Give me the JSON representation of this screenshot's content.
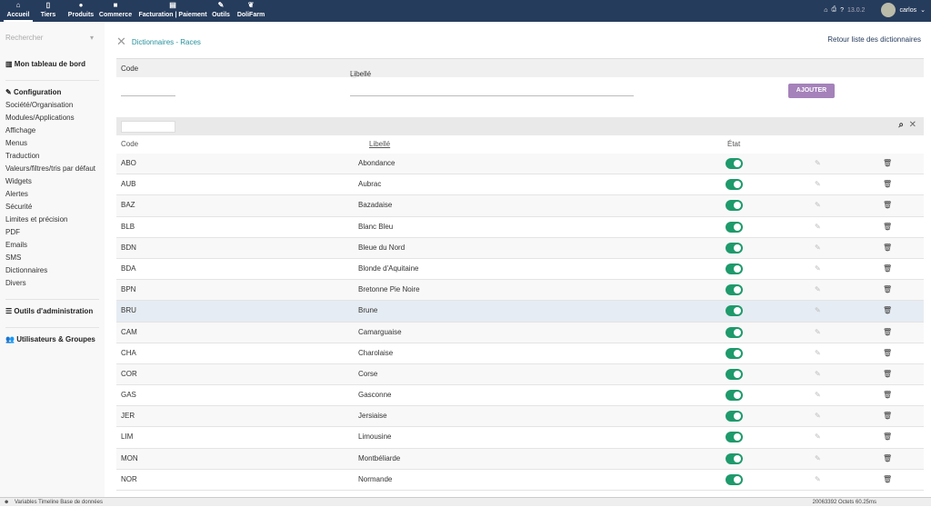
{
  "topbar": {
    "menus": [
      {
        "label": "Accueil",
        "icon": "home-icon",
        "glyph": "⌂"
      },
      {
        "label": "Tiers",
        "icon": "building-icon",
        "glyph": "▯"
      },
      {
        "label": "Produits",
        "icon": "cube-icon",
        "glyph": "●"
      },
      {
        "label": "Commerce",
        "icon": "briefcase-icon",
        "glyph": "■"
      },
      {
        "label": "Facturation | Paiement",
        "icon": "invoice-icon",
        "glyph": "▤"
      },
      {
        "label": "Outils",
        "icon": "wrench-icon",
        "glyph": "✎"
      },
      {
        "label": "DoliFarm",
        "icon": "leaf-icon",
        "glyph": "❦"
      }
    ],
    "version": "13.0.2",
    "user": "carlos"
  },
  "sidebar": {
    "search_placeholder": "Rechercher",
    "dashboard": "Mon tableau de bord",
    "config": "Configuration",
    "config_items": [
      "Société/Organisation",
      "Modules/Applications",
      "Affichage",
      "Menus",
      "Traduction",
      "Valeurs/filtres/tris par défaut",
      "Widgets",
      "Alertes",
      "Sécurité",
      "Limites et précision",
      "PDF",
      "Emails",
      "SMS",
      "Dictionnaires",
      "Divers"
    ],
    "admin_tools": "Outils d'administration",
    "users": "Utilisateurs & Groupes"
  },
  "main": {
    "title": "Dictionnaires - Races",
    "back": "Retour liste des dictionnaires",
    "form": {
      "code_label": "Code",
      "libelle_label": "Libellé",
      "add_button": "AJOUTER"
    },
    "columns": {
      "code": "Code",
      "libelle": "Libellé",
      "etat": "État"
    },
    "rows": [
      {
        "code": "ABO",
        "libelle": "Abondance"
      },
      {
        "code": "AUB",
        "libelle": "Aubrac"
      },
      {
        "code": "BAZ",
        "libelle": "Bazadaise"
      },
      {
        "code": "BLB",
        "libelle": "Blanc Bleu"
      },
      {
        "code": "BDN",
        "libelle": "Bleue du Nord"
      },
      {
        "code": "BDA",
        "libelle": "Blonde d'Aquitaine"
      },
      {
        "code": "BPN",
        "libelle": "Bretonne Pie Noire"
      },
      {
        "code": "BRU",
        "libelle": "Brune"
      },
      {
        "code": "CAM",
        "libelle": "Camarguaise"
      },
      {
        "code": "CHA",
        "libelle": "Charolaise"
      },
      {
        "code": "COR",
        "libelle": "Corse"
      },
      {
        "code": "GAS",
        "libelle": "Gasconne"
      },
      {
        "code": "JER",
        "libelle": "Jersiaise"
      },
      {
        "code": "LIM",
        "libelle": "Limousine"
      },
      {
        "code": "MON",
        "libelle": "Montbéliarde"
      },
      {
        "code": "NOR",
        "libelle": "Normande"
      }
    ]
  },
  "bottombar": {
    "left": "Variables  Timeline  Base de données",
    "right": "20063392 Octets   60.25ms"
  }
}
